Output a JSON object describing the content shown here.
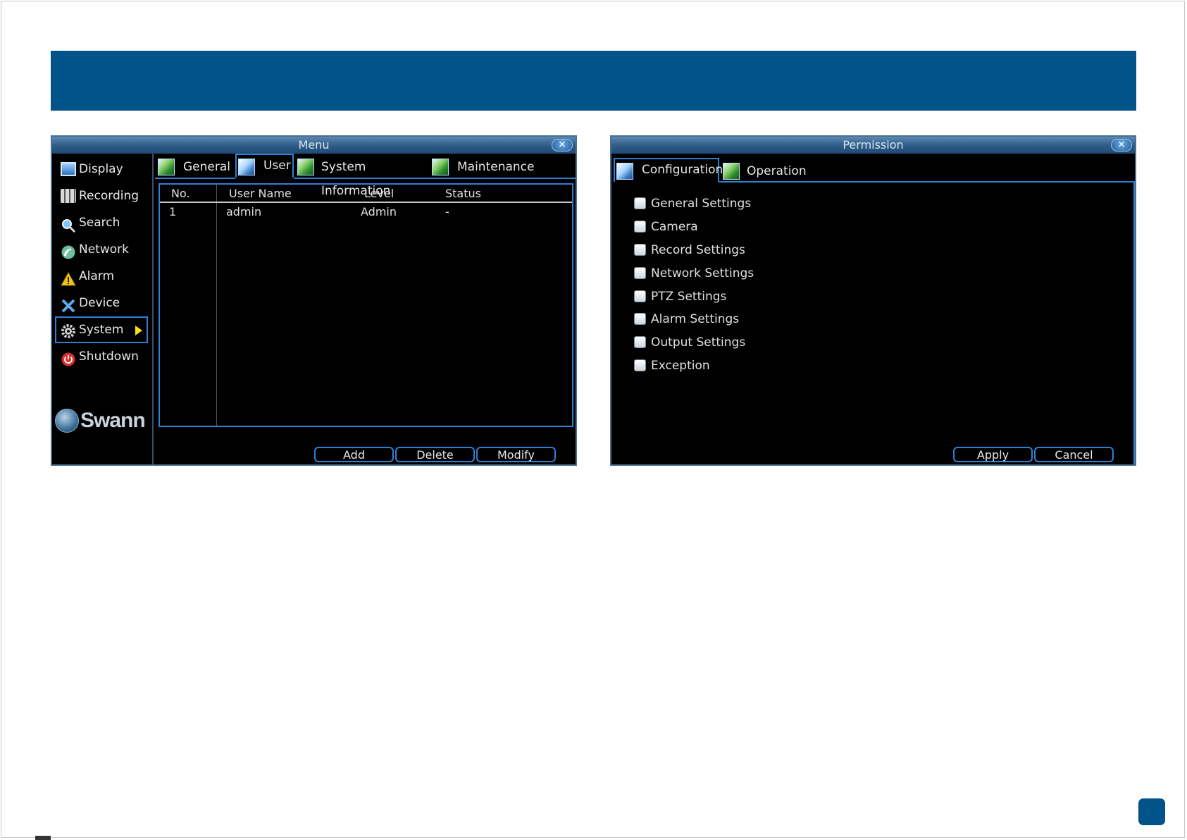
{
  "menu_window": {
    "title": "Menu",
    "close_glyph": "×",
    "sidebar": {
      "items": [
        {
          "label": "Display",
          "icon": "display-icon"
        },
        {
          "label": "Recording",
          "icon": "recording-icon"
        },
        {
          "label": "Search",
          "icon": "search-icon"
        },
        {
          "label": "Network",
          "icon": "network-icon"
        },
        {
          "label": "Alarm",
          "icon": "alarm-icon"
        },
        {
          "label": "Device",
          "icon": "device-icon"
        },
        {
          "label": "System",
          "icon": "gear-icon"
        },
        {
          "label": "Shutdown",
          "icon": "power-icon"
        }
      ],
      "active_item": "System",
      "logo_text": "Swann"
    },
    "tabs": [
      {
        "label": "General"
      },
      {
        "label": "User"
      },
      {
        "label": "System Information"
      },
      {
        "label": "Maintenance"
      }
    ],
    "active_tab": "User",
    "table": {
      "columns": [
        "No.",
        "User Name",
        "Level",
        "Status"
      ],
      "rows": [
        [
          "1",
          "admin",
          "Admin",
          "-"
        ]
      ]
    },
    "buttons": {
      "add": "Add",
      "delete": "Delete",
      "modify": "Modify"
    }
  },
  "permission_window": {
    "title": "Permission",
    "close_glyph": "×",
    "tabs": [
      {
        "label": "Configuration"
      },
      {
        "label": "Operation"
      }
    ],
    "active_tab": "Configuration",
    "options": [
      {
        "label": "General Settings",
        "checked": false
      },
      {
        "label": "Camera",
        "checked": false
      },
      {
        "label": "Record Settings",
        "checked": false
      },
      {
        "label": "Network Settings",
        "checked": false
      },
      {
        "label": "PTZ Settings",
        "checked": false
      },
      {
        "label": "Alarm Settings",
        "checked": false
      },
      {
        "label": "Output Settings",
        "checked": false
      },
      {
        "label": "Exception",
        "checked": false
      }
    ],
    "buttons": {
      "apply": "Apply",
      "cancel": "Cancel"
    }
  },
  "colors": {
    "banner": "#02538a",
    "accent_border": "#2f7fd4",
    "window_bg": "#000000",
    "selection_arrow": "#f2e60a"
  }
}
